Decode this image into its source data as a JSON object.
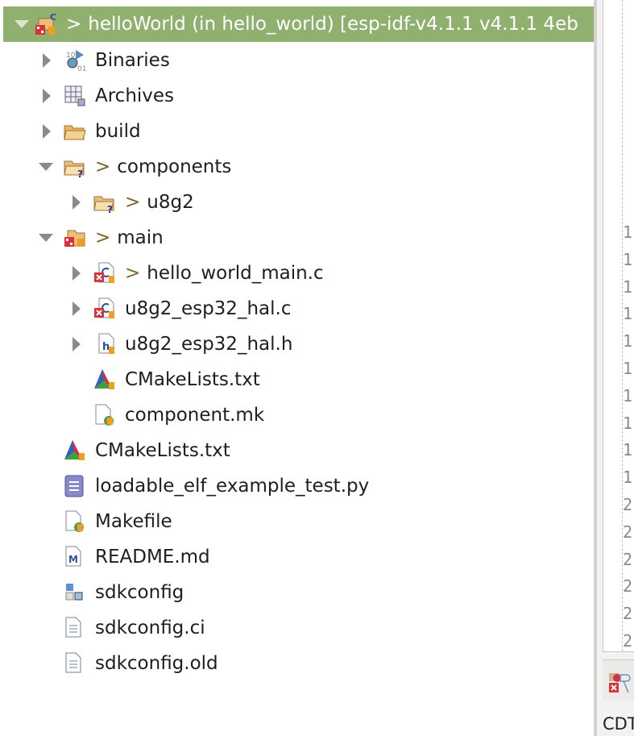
{
  "tree": {
    "project": {
      "prefix": ">",
      "label": "helloWorld (in hello_world) [esp-idf-v4.1.1 v4.1.1 4eb",
      "icon": "c-project-icon",
      "expanded": true
    },
    "items": [
      {
        "label": "Binaries",
        "prefix": "",
        "level": 1,
        "expander": "closed",
        "icon": "binaries-icon"
      },
      {
        "label": "Archives",
        "prefix": "",
        "level": 1,
        "expander": "closed",
        "icon": "archives-icon"
      },
      {
        "label": "build",
        "prefix": "",
        "level": 1,
        "expander": "closed",
        "icon": "folder-icon"
      },
      {
        "label": "components",
        "prefix": ">",
        "level": 1,
        "expander": "open",
        "icon": "folder-unknown-icon"
      },
      {
        "label": "u8g2",
        "prefix": ">",
        "level": 2,
        "expander": "closed",
        "icon": "folder-unknown-icon"
      },
      {
        "label": "main",
        "prefix": ">",
        "level": 1,
        "expander": "open",
        "icon": "source-folder-icon"
      },
      {
        "label": "hello_world_main.c",
        "prefix": ">",
        "level": 2,
        "expander": "closed",
        "icon": "c-file-icon"
      },
      {
        "label": "u8g2_esp32_hal.c",
        "prefix": "",
        "level": 2,
        "expander": "closed",
        "icon": "c-file-icon"
      },
      {
        "label": "u8g2_esp32_hal.h",
        "prefix": "",
        "level": 2,
        "expander": "closed",
        "icon": "h-file-icon"
      },
      {
        "label": "CMakeLists.txt",
        "prefix": "",
        "level": 2,
        "expander": "none",
        "icon": "cmake-icon"
      },
      {
        "label": "component.mk",
        "prefix": "",
        "level": 2,
        "expander": "none",
        "icon": "makefile-icon"
      },
      {
        "label": "CMakeLists.txt",
        "prefix": "",
        "level": 1,
        "expander": "none",
        "icon": "cmake-icon"
      },
      {
        "label": "loadable_elf_example_test.py",
        "prefix": "",
        "level": 1,
        "expander": "none",
        "icon": "python-file-icon"
      },
      {
        "label": "Makefile",
        "prefix": "",
        "level": 1,
        "expander": "none",
        "icon": "makefile-icon"
      },
      {
        "label": "README.md",
        "prefix": "",
        "level": 1,
        "expander": "none",
        "icon": "markdown-file-icon"
      },
      {
        "label": "sdkconfig",
        "prefix": "",
        "level": 1,
        "expander": "none",
        "icon": "sdkconfig-icon"
      },
      {
        "label": "sdkconfig.ci",
        "prefix": "",
        "level": 1,
        "expander": "none",
        "icon": "text-file-icon"
      },
      {
        "label": "sdkconfig.old",
        "prefix": "",
        "level": 1,
        "expander": "none",
        "icon": "text-file-icon"
      }
    ]
  },
  "editor": {
    "line_numbers": [
      "1",
      "1",
      "1",
      "1",
      "1",
      "1",
      "1",
      "1",
      "1",
      "1",
      "2",
      "2",
      "2",
      "2",
      "2",
      "2"
    ]
  },
  "bottom_panel": {
    "tab_label": "CDT"
  },
  "colors": {
    "selection": "#8fb06f",
    "folder": "#e8b860",
    "error_red": "#d9303a"
  }
}
